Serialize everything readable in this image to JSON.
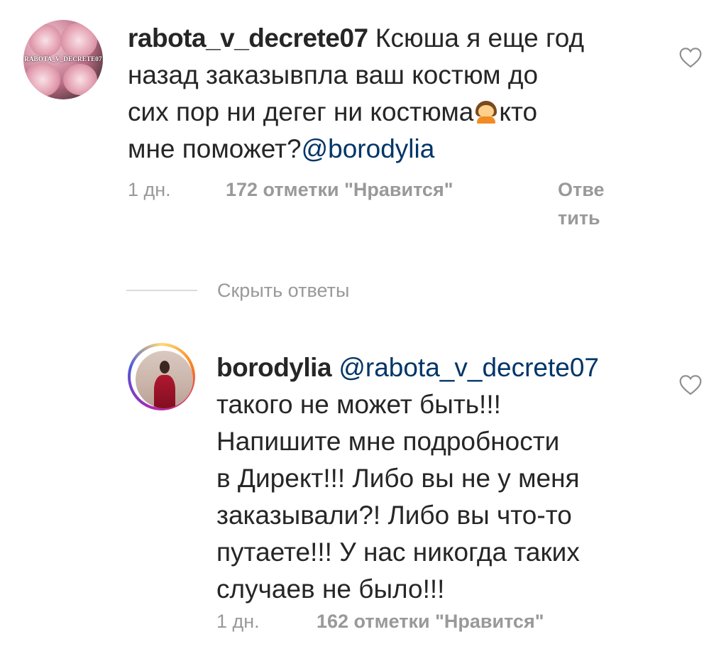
{
  "comment1": {
    "username": "rabota_v_decrete07",
    "avatar_caption": "RABOTA_V_DECRETE07",
    "line1": "Ксюша я еще год",
    "line2": "назад заказывпла ваш костюм до",
    "line3_a": "сих пор ни дегег ни костюма",
    "line3_b": "кто",
    "line4_text": "мне поможет?",
    "line4_mention": "@borodylia",
    "emoji": "person-gesturing-no-emoji",
    "time": "1 дн.",
    "likes": "172 отметки \"Нравится\"",
    "reply_line1": "Отве",
    "reply_line2": "тить"
  },
  "hide_replies": "Скрыть ответы",
  "comment2": {
    "username": "borodylia",
    "mention": "@rabota_v_decrete07",
    "line2": "такого не может быть!!!",
    "line3": "Напишите мне подробности",
    "line4": "в Директ!!! Либо вы не у меня",
    "line5": "заказывали?! Либо вы что-то",
    "line6": "путаете!!! У нас никогда таких",
    "line7": "случаев не было!!!",
    "time": "1 дн.",
    "likes": "162 отметки \"Нравится\""
  },
  "colors": {
    "text": "#262626",
    "meta": "#999999",
    "mention": "#003569",
    "divider": "#dbdbdb"
  }
}
